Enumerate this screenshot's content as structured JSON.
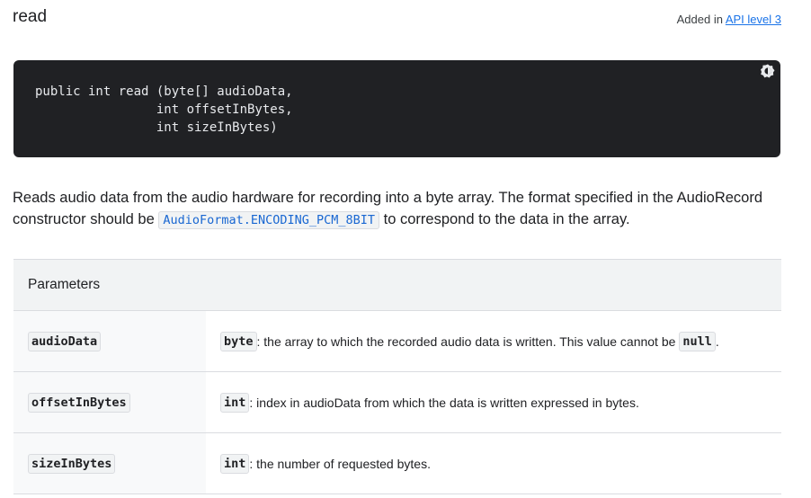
{
  "method": {
    "title": "read",
    "added_in_prefix": "Added in ",
    "added_in_link": "API level 3"
  },
  "code_block": {
    "signature": "public int read (byte[] audioData,\n                int offsetInBytes,\n                int sizeInBytes)",
    "theme_toggle_icon": "dark-mode-icon"
  },
  "description": {
    "part1": "Reads audio data from the audio hardware for recording into a byte array. The format specified in the AudioRecord constructor should be ",
    "code_link": "AudioFormat.ENCODING_PCM_8BIT",
    "part2": " to correspond to the data in the array."
  },
  "parameters": {
    "header": "Parameters",
    "rows": [
      {
        "name": "audioData",
        "type": "byte",
        "text": ": the array to which the recorded audio data is written. This value cannot be ",
        "trailing_code": "null",
        "trailing_text": "."
      },
      {
        "name": "offsetInBytes",
        "type": "int",
        "text": ": index in audioData from which the data is written expressed in bytes."
      },
      {
        "name": "sizeInBytes",
        "type": "int",
        "text": ": the number of requested bytes."
      }
    ]
  }
}
